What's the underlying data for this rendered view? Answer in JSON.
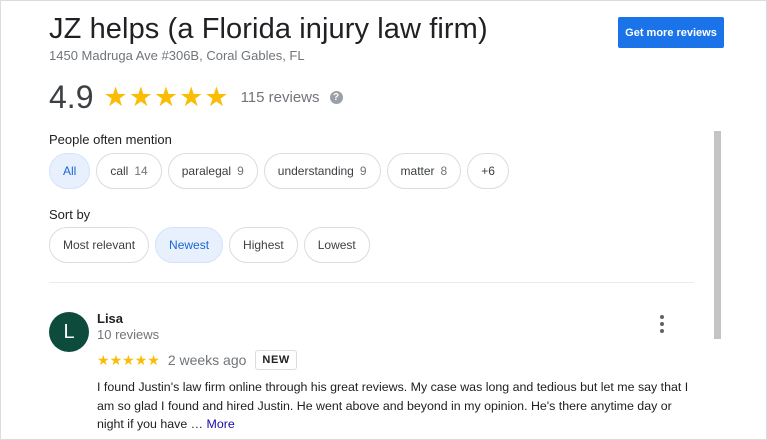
{
  "business": {
    "name": "JZ helps (a Florida injury law firm)",
    "address": "1450 Madruga Ave #306B, Coral Gables, FL"
  },
  "actions": {
    "get_more_reviews": "Get more reviews"
  },
  "rating": {
    "value": "4.9",
    "stars": 5,
    "review_count": "115 reviews",
    "help_icon": "?"
  },
  "mentions": {
    "label": "People often mention",
    "chips": [
      {
        "label": "All",
        "count": "",
        "selected": true
      },
      {
        "label": "call",
        "count": "14",
        "selected": false
      },
      {
        "label": "paralegal",
        "count": "9",
        "selected": false
      },
      {
        "label": "understanding",
        "count": "9",
        "selected": false
      },
      {
        "label": "matter",
        "count": "8",
        "selected": false
      },
      {
        "label": "+6",
        "count": "",
        "selected": false
      }
    ]
  },
  "sort": {
    "label": "Sort by",
    "options": [
      {
        "label": "Most relevant",
        "selected": false
      },
      {
        "label": "Newest",
        "selected": true
      },
      {
        "label": "Highest",
        "selected": false
      },
      {
        "label": "Lowest",
        "selected": false
      }
    ]
  },
  "reviews": [
    {
      "avatar_letter": "L",
      "name": "Lisa",
      "meta": "10 reviews",
      "stars": 5,
      "time_ago": "2 weeks ago",
      "badge": "NEW",
      "text": "I found Justin's law firm online through his great reviews. My case was long and tedious but let me say that I am so glad I found and hired Justin. He went above and beyond in my opinion. He's there anytime day or night if you have …",
      "more_label": "More"
    }
  ],
  "colors": {
    "accent": "#1a73e8",
    "star": "#fbbc04",
    "avatar_bg": "#0d4b3c",
    "chip_selected_bg": "#e8f0fe"
  }
}
